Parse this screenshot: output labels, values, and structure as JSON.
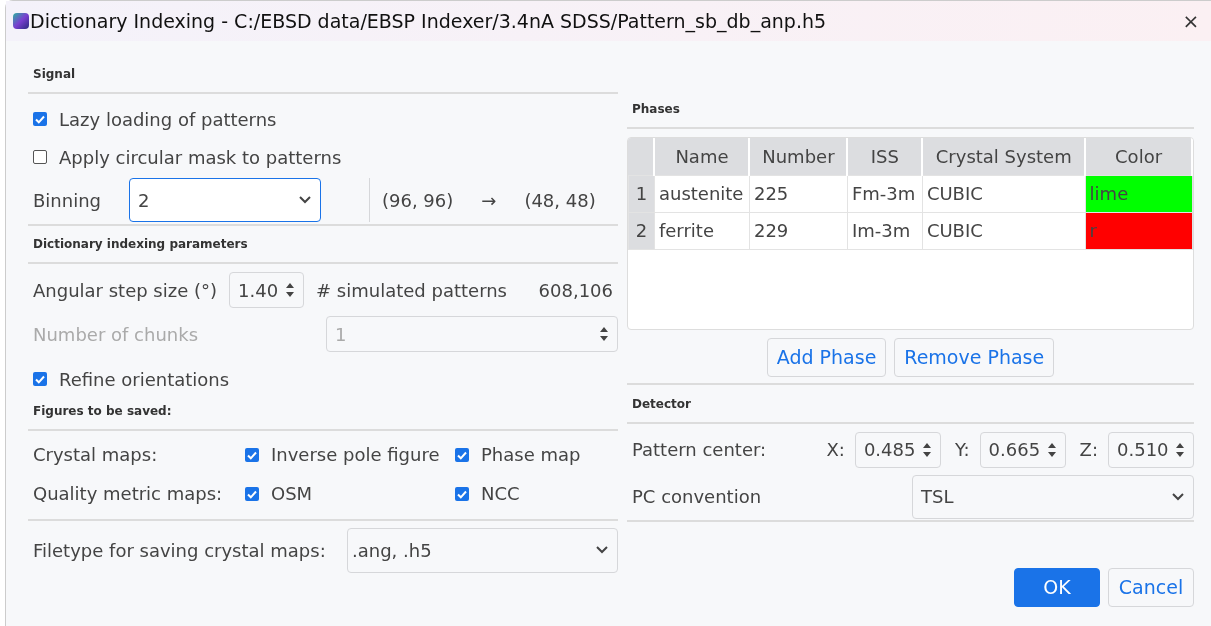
{
  "window": {
    "title": "Dictionary Indexing - C:/EBSD data/EBSP Indexer/3.4nA SDSS/Pattern_sb_db_anp.h5",
    "close": "×"
  },
  "signal": {
    "heading": "Signal",
    "checkboxes": [
      {
        "label": "Lazy loading of patterns",
        "checked": true
      },
      {
        "label": "Apply circular mask to patterns",
        "checked": false
      }
    ],
    "binning": {
      "label": "Binning",
      "value": "2",
      "focused": true,
      "shape_from": "(96, 96)",
      "arrow": "→",
      "shape_to": "(48, 48)"
    }
  },
  "dictionary_indexing": {
    "heading": "Dictionary indexing parameters",
    "angular_step": {
      "label": "Angular step size (°)",
      "value": "1.40"
    },
    "simulated": {
      "label": "# simulated patterns",
      "value": "608,106"
    },
    "chunks": {
      "label": "Number of chunks",
      "value": "1",
      "disabled": true
    },
    "refine": {
      "label": "Refine orientations",
      "checked": true
    }
  },
  "figures": {
    "heading": "Figures to be saved:",
    "rows": [
      {
        "label": "Crystal maps:",
        "options": [
          {
            "label": "Inverse pole figure",
            "checked": true
          },
          {
            "label": "Phase map",
            "checked": true
          }
        ]
      },
      {
        "label": "Quality metric maps:",
        "options": [
          {
            "label": "OSM",
            "checked": true
          },
          {
            "label": "NCC",
            "checked": true
          }
        ]
      }
    ],
    "filetype": {
      "label": "Filetype for saving crystal maps:",
      "value": ".ang, .h5"
    }
  },
  "phases": {
    "heading": "Phases",
    "table": {
      "columns": [
        "Name",
        "Number",
        "ISS",
        "Crystal System",
        "Color"
      ],
      "rows": [
        {
          "index": "1",
          "cells": [
            "austenite",
            "225",
            "Fm-3m",
            "CUBIC"
          ],
          "color_name": "lime",
          "color": "#00ff00"
        },
        {
          "index": "2",
          "cells": [
            "ferrite",
            "229",
            "Im-3m",
            "CUBIC"
          ],
          "color_name": "r",
          "color": "#ff0000"
        }
      ]
    },
    "buttons": [
      "Add Phase",
      "Remove Phase"
    ]
  },
  "detector": {
    "heading": "Detector",
    "pattern_center": {
      "label": "Pattern center:",
      "coords": [
        {
          "axis": "X:",
          "value": "0.485"
        },
        {
          "axis": "Y:",
          "value": "0.665"
        },
        {
          "axis": "Z:",
          "value": "0.510"
        }
      ]
    },
    "pc_convention": {
      "label": "PC convention",
      "value": "TSL"
    }
  },
  "buttons": [
    {
      "label": "OK",
      "primary": true
    },
    {
      "label": "Cancel",
      "primary": false
    }
  ]
}
